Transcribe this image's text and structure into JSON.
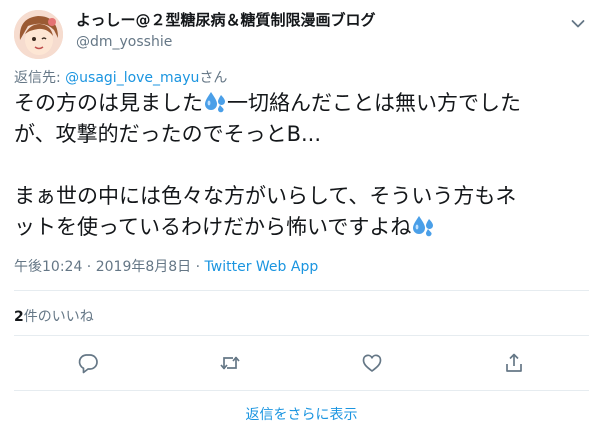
{
  "tweet": {
    "display_name": "よっしー@２型糖尿病＆糖質制限漫画ブログ",
    "handle": "@dm_yosshie",
    "reply_prefix": "返信先: ",
    "reply_mention": "@usagi_love_mayu",
    "reply_suffix": "さん",
    "line1a": "その方のは見ました",
    "line1b": "一切絡んだことは無い方でした",
    "line2": "が、攻撃的だったのでそっとB...",
    "line3": "まぁ世の中には色々な方がいらして、そういう方もネ",
    "line4": "ットを使っているわけだから怖いですよね",
    "time": "午後10:24",
    "separator": " · ",
    "date": "2019年8月8日",
    "source": "Twitter Web App",
    "likes_count": "2",
    "likes_label": "件のいいね"
  },
  "footer": {
    "more_replies": "返信をさらに表示"
  },
  "icons": {
    "caret": "chevron-down-icon",
    "reply": "reply-icon",
    "retweet": "retweet-icon",
    "like": "heart-icon",
    "share": "share-icon",
    "drops": "sweat-droplets-icon"
  },
  "colors": {
    "link": "#1b95e0",
    "secondary_text": "#657786",
    "primary_text": "#14171a",
    "divider": "#e6ecf0"
  }
}
